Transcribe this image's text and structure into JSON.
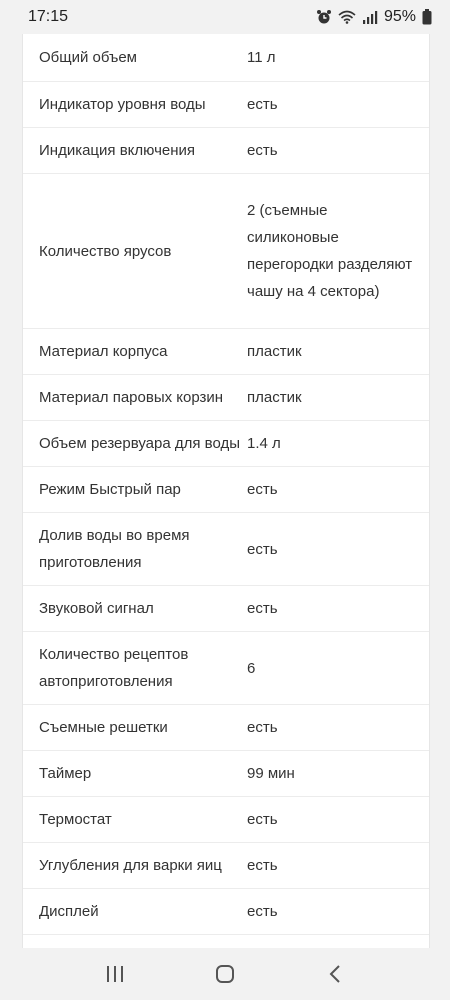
{
  "status_bar": {
    "time": "17:15",
    "battery": "95%",
    "icons": [
      "alarm-icon",
      "wifi-icon",
      "signal-icon",
      "battery-icon"
    ]
  },
  "specs": [
    {
      "label": "Общий объем",
      "value": "11 л"
    },
    {
      "label": "Индикатор уровня воды",
      "value": "есть"
    },
    {
      "label": "Индикация включения",
      "value": "есть"
    },
    {
      "label": "Количество ярусов",
      "value": "2 (съемные силиконовые перегородки разделяют чашу на 4 сектора)"
    },
    {
      "label": "Материал корпуса",
      "value": "пластик"
    },
    {
      "label": "Материал паровых корзин",
      "value": "пластик"
    },
    {
      "label": "Объем резервуара для воды",
      "value": "1.4 л"
    },
    {
      "label": "Режим Быстрый пар",
      "value": "есть"
    },
    {
      "label": "Долив воды во время приготовления",
      "value": "есть"
    },
    {
      "label": "Звуковой сигнал",
      "value": "есть"
    },
    {
      "label": "Количество рецептов автоприготовления",
      "value": "6"
    },
    {
      "label": "Съемные решетки",
      "value": "есть"
    },
    {
      "label": "Таймер",
      "value": "99 мин"
    },
    {
      "label": "Термостат",
      "value": "есть"
    },
    {
      "label": "Углубления для варки яиц",
      "value": "есть"
    },
    {
      "label": "Дисплей",
      "value": "есть"
    }
  ],
  "nav_bar": {
    "buttons": [
      "recents-icon",
      "home-icon",
      "back-icon"
    ]
  }
}
